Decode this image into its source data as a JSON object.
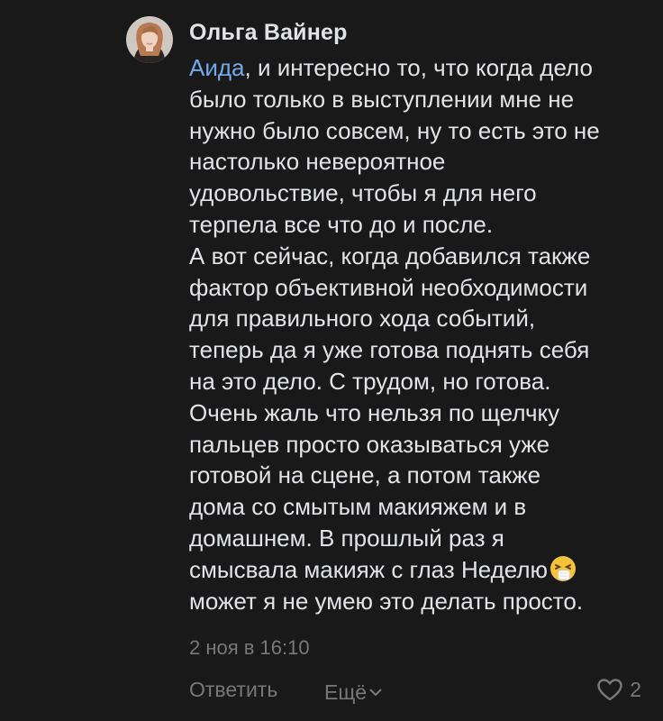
{
  "comment": {
    "author": "Ольга Вайнер",
    "mention": "Аида",
    "lines": [
      ", и интересно то, что когда дело",
      "было только в выступлении мне не",
      "нужно было совсем, ну то есть это не",
      "настолько невероятное",
      "удовольствие, чтобы я для него",
      "терпела все что до и после.",
      "А вот сейчас, когда добавился также",
      "фактор объективной необходимости",
      "для правильного хода событий,",
      "теперь да я уже готова поднять себя",
      "на это дело. С трудом, но готова.",
      "Очень жаль что нельзя по щелчку",
      "пальцев просто оказываться уже",
      "готовой на сцене, а потом также",
      "дома со смытым макияжем и в",
      "домашнем. В прошлый раз я",
      "смысвала макияж с глаз Неделю",
      "может я не умею это делать просто."
    ],
    "emoji": "sneezing-face-icon",
    "date": "2 ноя в 16:10",
    "actions": {
      "reply": "Ответить",
      "more": "Ещё",
      "likes": "2"
    }
  },
  "colors": {
    "background": "#19191a",
    "text": "#e1e3e6",
    "mention": "#71aaeb",
    "secondary": "#76787a"
  }
}
